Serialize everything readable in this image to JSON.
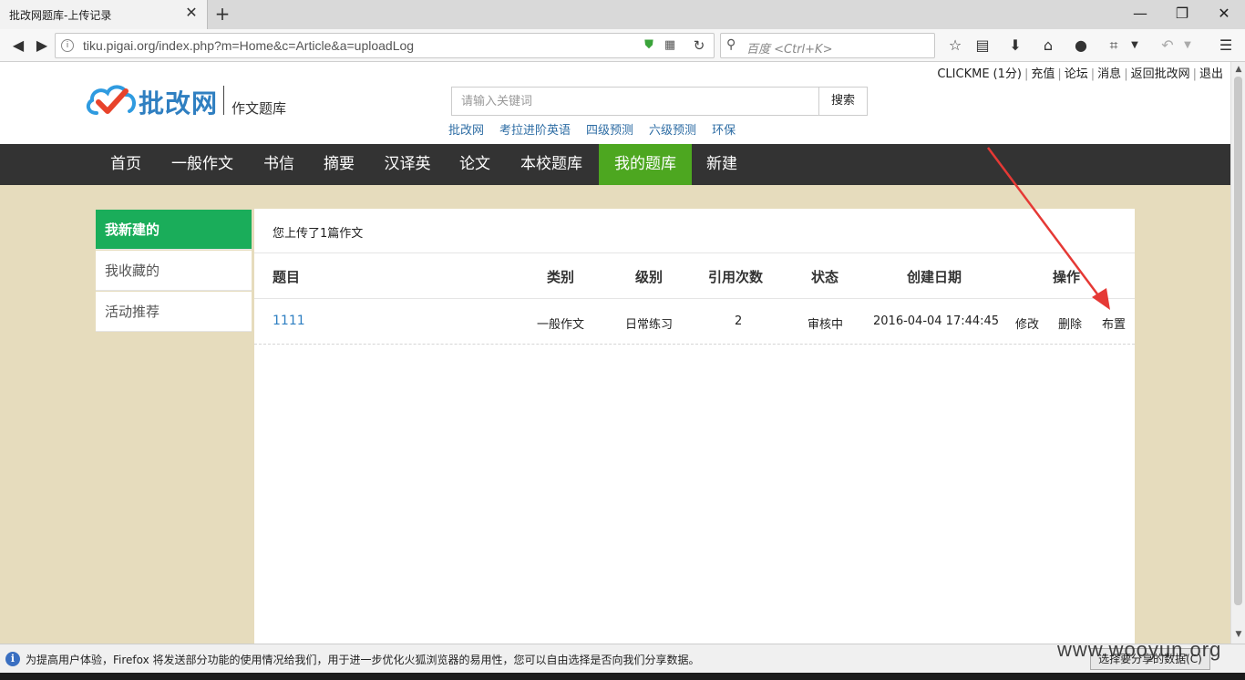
{
  "browser": {
    "tab_title": "批改网题库-上传记录",
    "tab_close": "✕",
    "new_tab": "+",
    "url": "tiku.pigai.org/index.php?m=Home&c=Article&a=uploadLog",
    "search_placeholder": "百度 <Ctrl+K>",
    "window_controls": {
      "minimize": "—",
      "restore": "❐",
      "close": "✕"
    }
  },
  "header": {
    "user_links": {
      "user": "CLICKME",
      "points": "(1分)",
      "recharge": "充值",
      "forum": "论坛",
      "messages": "消息",
      "back": "返回批改网",
      "logout": "退出"
    },
    "logo_text": "批改网",
    "logo_sub": "作文题库",
    "search_placeholder": "请输入关键词",
    "search_button": "搜索",
    "hot_links": [
      "批改网",
      "考拉进阶英语",
      "四级预测",
      "六级预测",
      "环保"
    ]
  },
  "nav": {
    "items": [
      "首页",
      "一般作文",
      "书信",
      "摘要",
      "汉译英",
      "论文",
      "本校题库",
      "我的题库",
      "新建"
    ],
    "active": "我的题库"
  },
  "sidebar": {
    "items": [
      "我新建的",
      "我收藏的",
      "活动推荐"
    ],
    "active": "我新建的"
  },
  "content": {
    "summary": "您上传了1篇作文",
    "columns": [
      "题目",
      "类别",
      "级别",
      "引用次数",
      "状态",
      "创建日期",
      "操作"
    ],
    "rows": [
      {
        "title": "1111",
        "category": "一般作文",
        "level": "日常练习",
        "citations": "2",
        "status": "审核中",
        "created": "2016-04-04 17:44:45",
        "actions": [
          "修改",
          "删除",
          "布置"
        ]
      }
    ]
  },
  "notification": {
    "text": "为提高用户体验，Firefox 将发送部分功能的使用情况给我们，用于进一步优化火狐浏览器的易用性，您可以自由选择是否向我们分享数据。",
    "button": "选择要分享的数据(C)",
    "icon": "i"
  },
  "watermark": "www.wooyun.org",
  "colors": {
    "page_bg": "#e6dcbd",
    "nav_bg": "#333333",
    "nav_active": "#4da720",
    "sidebar_active": "#1aad5a",
    "link": "#2e7fc2",
    "annotation_arrow": "#e53935"
  }
}
